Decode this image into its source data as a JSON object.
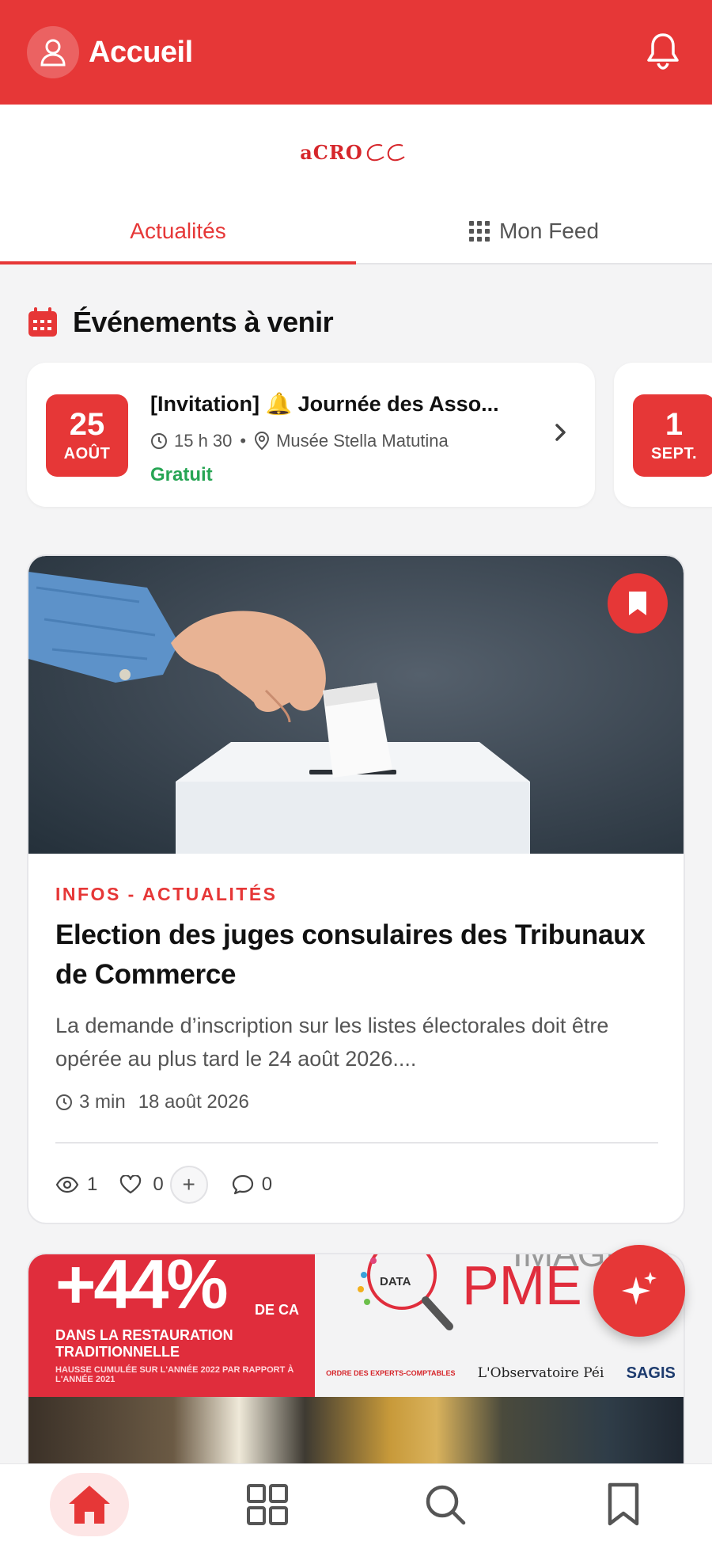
{
  "header": {
    "title": "Accueil",
    "avatar_icon": "user-icon",
    "notification_icon": "bell-icon"
  },
  "brand": {
    "logo_text": "aCRO"
  },
  "tabs": [
    {
      "label": "Actualités",
      "active": true
    },
    {
      "label": "Mon Feed",
      "active": false,
      "icon": "grid-dots-icon"
    }
  ],
  "events_section": {
    "title": "Événements à venir",
    "icon": "calendar-icon",
    "events": [
      {
        "day": "25",
        "month": "AOÛT",
        "title": "[Invitation] 🔔 Journée des Asso...",
        "time": "15 h 30",
        "separator": "•",
        "location": "Musée Stella Matutina",
        "price": "Gratuit"
      },
      {
        "day": "1",
        "month": "SEPT."
      }
    ]
  },
  "article": {
    "category": "INFOS - ACTUALITÉS",
    "title": "Election des juges consulaires des Tribunaux de Commerce",
    "excerpt": "La demande d’inscription sur les listes électorales doit être opérée au plus tard le 24 août 2026....",
    "read_time": "3 min",
    "date": "18 août 2026",
    "views": "1",
    "likes": "0",
    "comments": "0",
    "plus_label": "+"
  },
  "promo": {
    "big_number": "+44%",
    "unit": "DE CA",
    "line1": "DANS LA RESTAURATION TRADITIONNELLE",
    "line2": "HAUSSE CUMULÉE SUR L'ANNÉE 2022 PAR RAPPORT À L'ANNÉE 2021",
    "image_word": "IMAGE",
    "pme_word": "PME",
    "data_word": "DATA",
    "partner1": "ORDRE DES EXPERTS-COMPTABLES",
    "partner2": "L'Observatoire Péi",
    "partner3": "SAGIS"
  },
  "colors": {
    "brand_red": "#e63737",
    "price_green": "#27a554"
  },
  "bottom_nav": [
    {
      "name": "home",
      "icon": "home-icon",
      "active": true
    },
    {
      "name": "categories",
      "icon": "grid-icon",
      "active": false
    },
    {
      "name": "search",
      "icon": "search-icon",
      "active": false
    },
    {
      "name": "saved",
      "icon": "bookmark-icon",
      "active": false
    }
  ]
}
